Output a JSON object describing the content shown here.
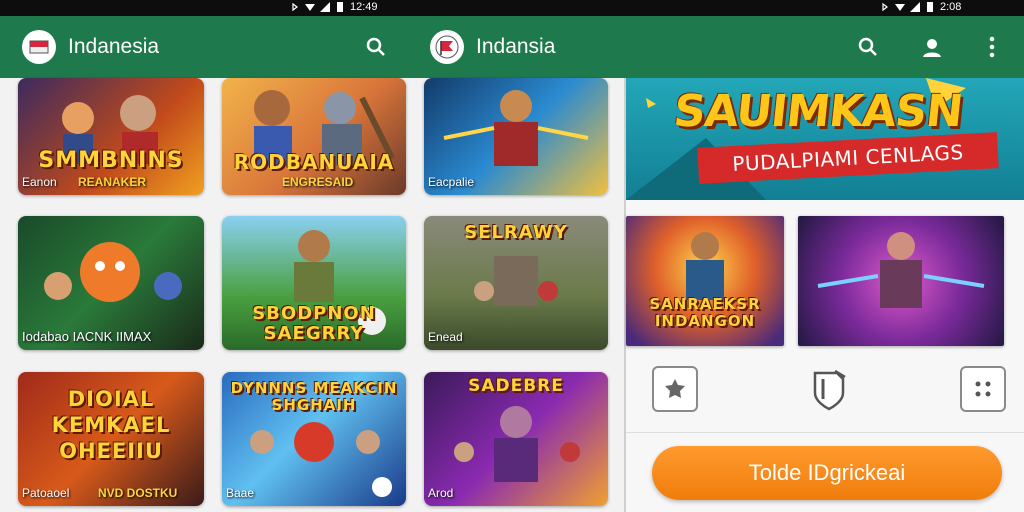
{
  "status_bar": {
    "left_time": "12:49",
    "right_time": "2:08"
  },
  "left_app": {
    "title": "Indanesia",
    "icons": [
      "flag-logo-icon",
      "search-icon"
    ]
  },
  "right_app": {
    "title": "Indansia",
    "icons": [
      "flag-logo-icon",
      "search-icon",
      "person-icon",
      "more-vert-icon"
    ]
  },
  "grid": [
    {
      "title": "SMMBNINS",
      "subtitle": "REANAKER",
      "caption": "Eanon"
    },
    {
      "title": "RODBANUAIA",
      "subtitle": "ENGRESAID",
      "caption": ""
    },
    {
      "title": "",
      "subtitle": "",
      "caption": "Eacpalie"
    },
    {
      "title": "",
      "subtitle": "",
      "caption": "Iodabao IACNK IIMAX"
    },
    {
      "title": "SBODPNON SAEGRRY",
      "subtitle": "",
      "caption": ""
    },
    {
      "title": "SELRAWY",
      "subtitle": "",
      "caption": "Enead"
    },
    {
      "title": "DIOIAL KEMKAEL OHEEIIU",
      "subtitle": "",
      "caption": "Patoaoel",
      "caption2": "NVD DOSTKU"
    },
    {
      "title": "DYNNNS MEAKCIN SHGHAIH",
      "subtitle": "",
      "caption": "Baae"
    },
    {
      "title": "SADEBRE",
      "subtitle": "",
      "caption": "Arod"
    }
  ],
  "banner": {
    "title": "SAUIMKASN",
    "ribbon": "PUDALPIAMI CENLAGS"
  },
  "feature_cards": [
    {
      "title": "SANRAEKSR INDANGON"
    },
    {
      "title": ""
    }
  ],
  "action_icons": [
    "game-badge-icon",
    "shield-flag-icon",
    "grid-dots-icon"
  ],
  "cta_label": "Tolde IDgrickeai",
  "colors": {
    "appbar": "#1e7a4c",
    "cta": "#f28a1a",
    "banner": "#1a93a6"
  }
}
